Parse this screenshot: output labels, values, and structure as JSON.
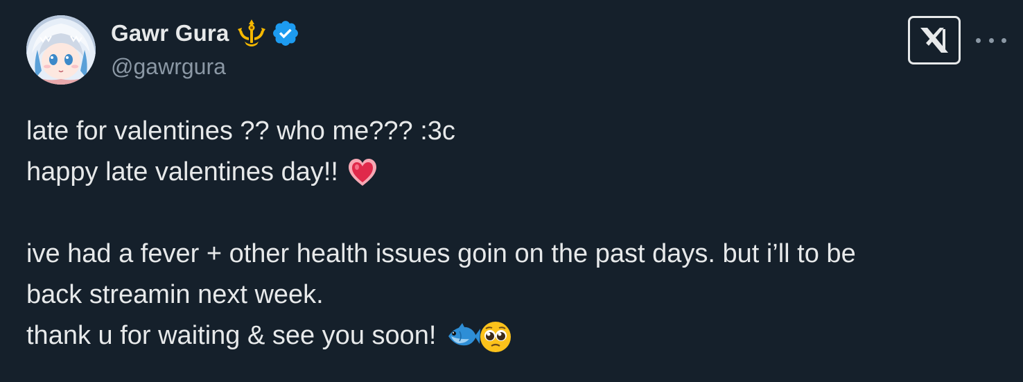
{
  "author": {
    "display_name": "Gawr Gura",
    "handle": "@gawrgura",
    "affiliation_badge": "trident-crown-icon",
    "verified_badge": "verified-checkmark-icon",
    "avatar": "avatar-shark-girl"
  },
  "header_actions": {
    "platform_logo": "x-logo-icon",
    "more_menu": "more-horizontal-icon"
  },
  "tweet": {
    "line1": "late for valentines ?? who me??? :3c",
    "line2": "happy late valentines day!!",
    "line2_emoji": "heart-icon",
    "line3": "ive had a fever + other health issues goin on the past days. but i’ll to be",
    "line4": "back streamin next week.",
    "line5": "thank u for waiting & see you soon!",
    "line5_emojis": [
      "fish-icon",
      "pleading-face-icon"
    ]
  },
  "colors": {
    "background": "#15202b",
    "text_primary": "#e7e9ea",
    "text_secondary": "#8b98a5",
    "verified_blue": "#1d9bf0",
    "badge_gold": "#f5b800"
  }
}
